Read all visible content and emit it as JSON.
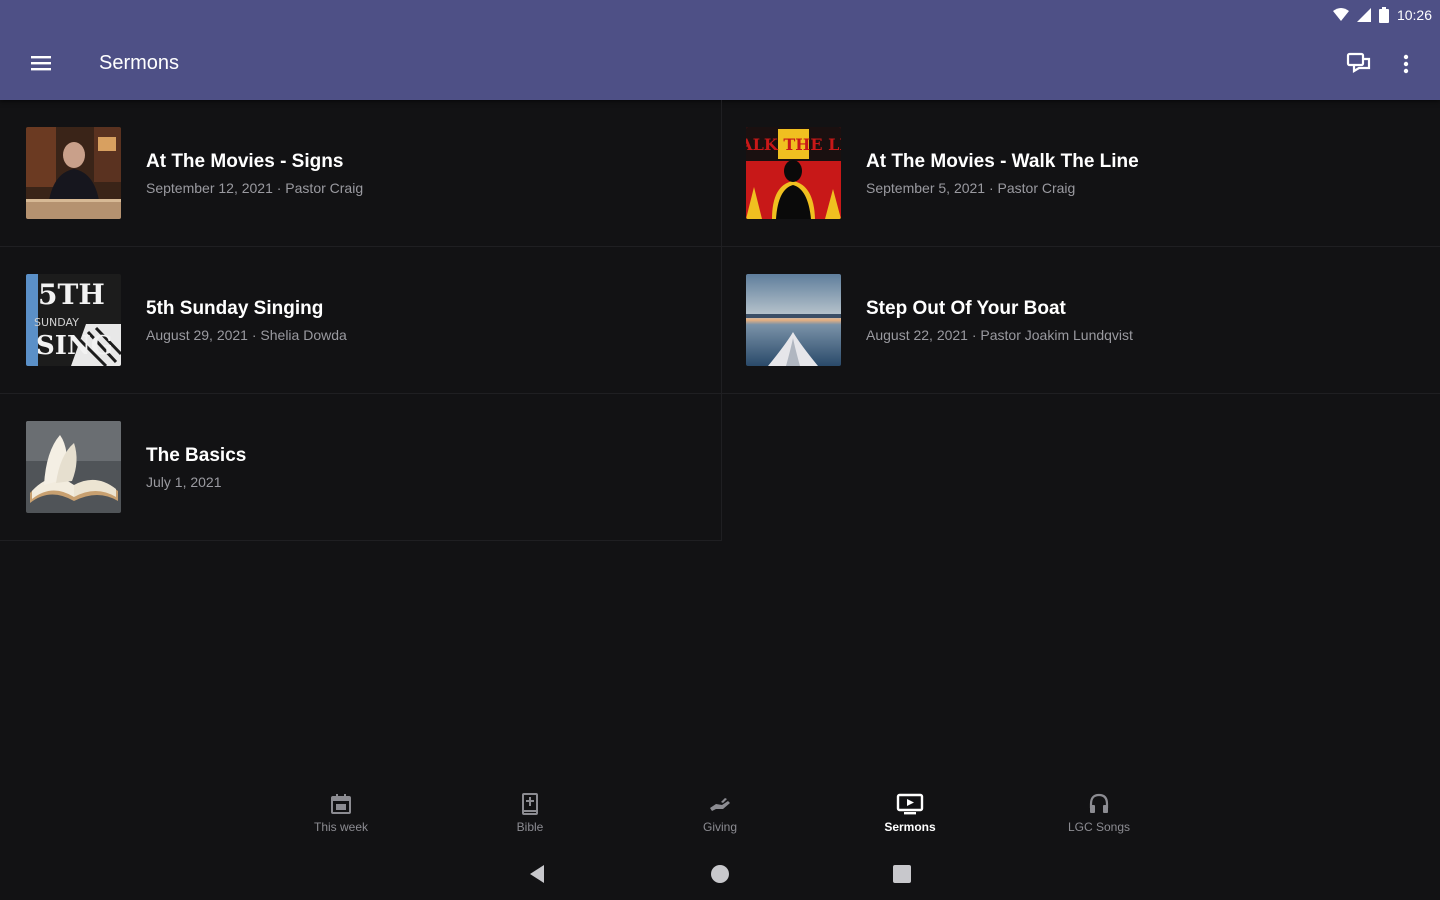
{
  "status_bar": {
    "time": "10:26"
  },
  "app_bar": {
    "title": "Sermons",
    "menu_icon": "hamburger-menu-icon",
    "chat_icon": "chat-bubbles-icon",
    "more_icon": "more-vert-icon"
  },
  "sermons": [
    {
      "title": "At The Movies - Signs",
      "subtitle": "September 12, 2021 · Pastor Craig",
      "thumb": "man-at-desk-thumbnail"
    },
    {
      "title": "At The Movies - Walk The Line",
      "subtitle": "September 5, 2021 · Pastor Craig",
      "thumb": "walk-the-line-poster-thumbnail",
      "thumb_text": "ALK THE LI"
    },
    {
      "title": "5th Sunday Singing",
      "subtitle": "August 29, 2021 · Shelia Dowda",
      "thumb": "5th-sunday-singing-thumbnail",
      "thumb_text_1": "5TH",
      "thumb_text_2": "SUNDAY",
      "thumb_text_3": "SING"
    },
    {
      "title": "Step Out Of Your Boat",
      "subtitle": "August 22, 2021 · Pastor Joakim Lundqvist",
      "thumb": "boat-on-water-thumbnail"
    },
    {
      "title": "The Basics",
      "subtitle": "July 1, 2021",
      "thumb": "open-bible-thumbnail"
    }
  ],
  "bottom_nav": [
    {
      "label": "This week",
      "icon": "calendar-icon",
      "active": false
    },
    {
      "label": "Bible",
      "icon": "bible-icon",
      "active": false
    },
    {
      "label": "Giving",
      "icon": "giving-hand-icon",
      "active": false
    },
    {
      "label": "Sermons",
      "icon": "tv-play-icon",
      "active": true
    },
    {
      "label": "LGC Songs",
      "icon": "headphones-icon",
      "active": false
    }
  ],
  "colors": {
    "app_bar": "#4e5086",
    "background": "#121214",
    "subtitle": "#9a9aa0"
  }
}
